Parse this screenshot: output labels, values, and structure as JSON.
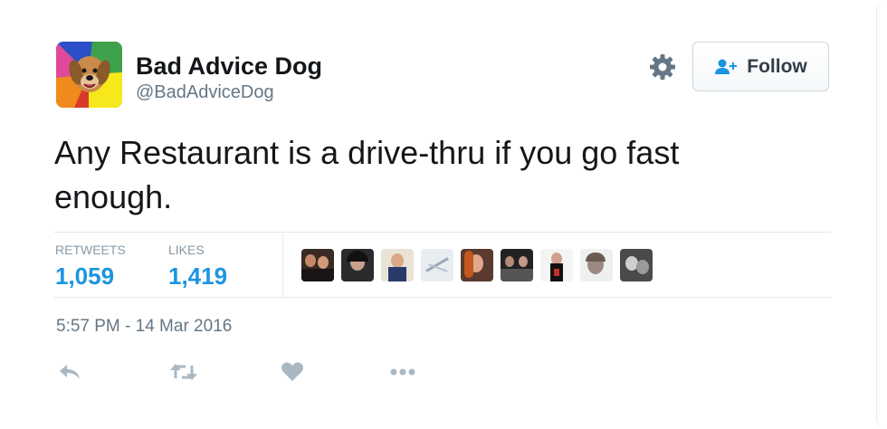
{
  "author": {
    "name": "Bad Advice Dog",
    "handle": "@BadAdviceDog",
    "avatar_icon": "bad-advice-dog-avatar",
    "avatar_colors": [
      "#d9392c",
      "#f6b21b",
      "#2d4ec9",
      "#3fa14c",
      "#e0489b"
    ]
  },
  "header": {
    "settings_icon": "gear-icon",
    "follow_label": "Follow",
    "follow_icon": "add-user-icon"
  },
  "tweet": {
    "text": "Any Restaurant is a drive-thru if you go fast enough."
  },
  "stats": {
    "retweets_label": "RETWEETS",
    "retweets_value": "1,059",
    "likes_label": "LIKES",
    "likes_value": "1,419"
  },
  "likers_count_shown": 9,
  "timestamp": "5:57 PM - 14 Mar 2016",
  "actions": [
    {
      "name": "reply",
      "icon": "reply-icon"
    },
    {
      "name": "retweet",
      "icon": "retweet-icon"
    },
    {
      "name": "like",
      "icon": "heart-icon"
    },
    {
      "name": "more",
      "icon": "more-icon"
    }
  ],
  "colors": {
    "accent": "#1b95e0",
    "text": "#14171a",
    "muted": "#657786",
    "icon": "#aab8c2"
  }
}
